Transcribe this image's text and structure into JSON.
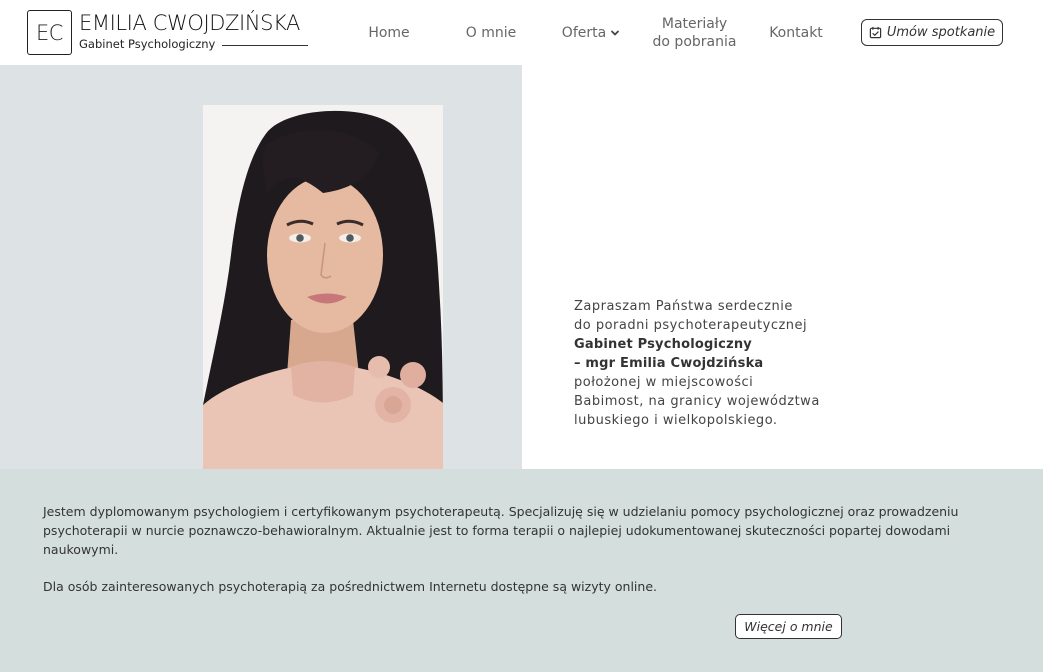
{
  "header": {
    "logo_initials": "EC",
    "logo_name": "EMILIA CWOJDZIŃSKA",
    "logo_subtitle": "Gabinet Psychologiczny"
  },
  "nav": {
    "home": "Home",
    "about": "O mnie",
    "offer": "Oferta",
    "materials_line1": "Materiały",
    "materials_line2": "do pobrania",
    "contact": "Kontakt",
    "cta": "Umów spotkanie"
  },
  "hero": {
    "line1": "Zapraszam Państwa serdecznie",
    "line2": "do poradni psychoterapeutycznej",
    "line3_bold": "Gabinet Psychologiczny",
    "line4_bold": "– mgr Emilia Cwojdzińska",
    "line5": "położonej w miejscowości",
    "line6": "Babimost, na granicy województwa",
    "line7": "lubuskiego i wielkopolskiego."
  },
  "about": {
    "paragraph1": "Jestem dyplomowanym psychologiem i certyfikowanym psychoterapeutą. Specjalizuję się w udzielaniu pomocy psychologicznej oraz prowadzeniu psychoterapii w nurcie poznawczo-behawioralnym. Aktualnie jest to forma terapii o najlepiej udokumentowanej skuteczności popartej dowodami naukowymi.",
    "paragraph2": "Dla osób zainteresowanych psychoterapią za pośrednictwem Internetu dostępne są wizyty online.",
    "more_button": "Więcej o mnie"
  },
  "icons": {
    "cta_icon": "calendar-check-icon",
    "dropdown_icon": "chevron-down-icon"
  },
  "colors": {
    "photo_bg": "#dde2e4",
    "about_bg": "#d4dfdd",
    "text": "#333333",
    "nav_text": "#666666"
  }
}
